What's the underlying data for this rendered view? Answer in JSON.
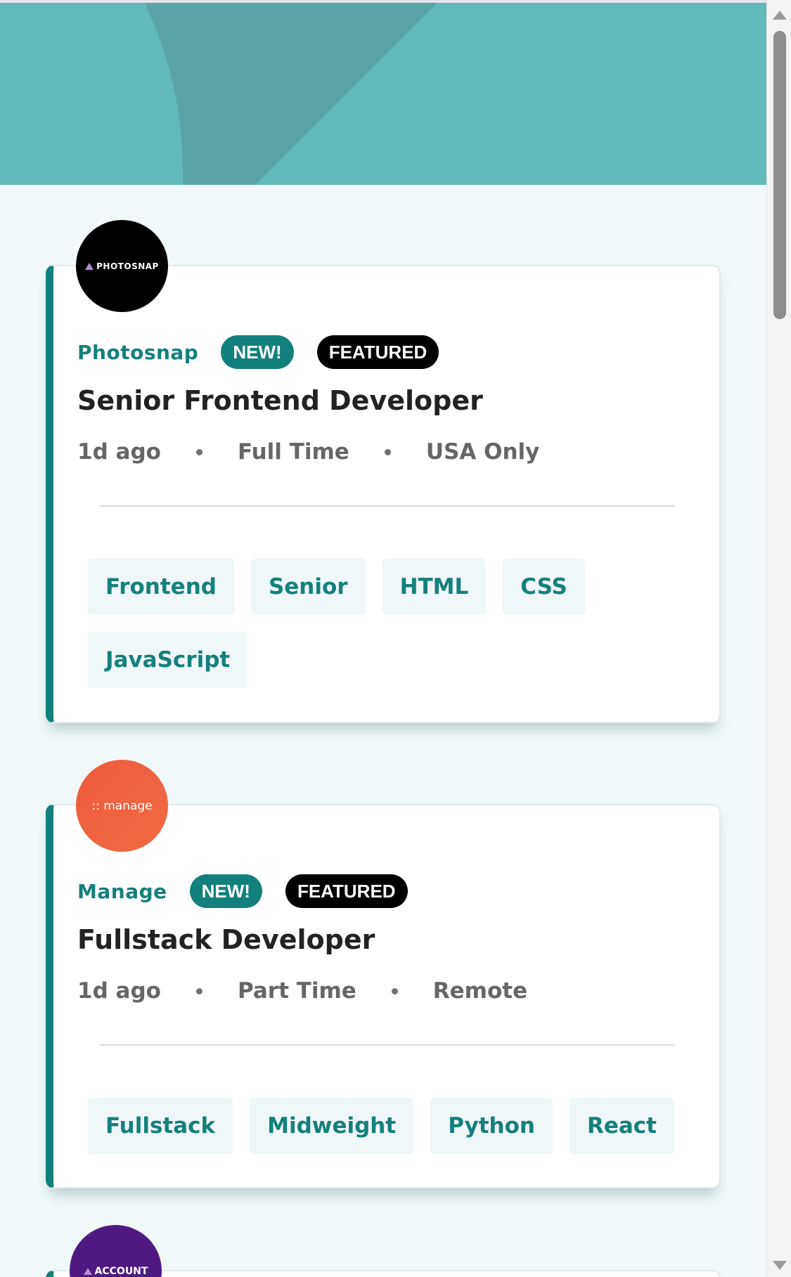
{
  "colors": {
    "primary": "#14807c",
    "header_bg": "#63baba",
    "page_bg": "#f0f8f9",
    "tag_bg": "#eff7f8",
    "featured_bg": "#000000",
    "text_dark": "#222222",
    "text_muted": "#666666"
  },
  "jobs": [
    {
      "logo_text": "PHOTOSNAP",
      "logo_icon": "triangle-logo-icon",
      "company": "Photosnap",
      "new_label": "NEW!",
      "featured_label": "FEATURED",
      "title": "Senior Frontend Developer",
      "posted": "1d ago",
      "contract": "Full Time",
      "location": "USA Only",
      "tags": [
        "Frontend",
        "Senior",
        "HTML",
        "CSS",
        "JavaScript"
      ]
    },
    {
      "logo_text": ":: manage",
      "company": "Manage",
      "new_label": "NEW!",
      "featured_label": "FEATURED",
      "title": "Fullstack Developer",
      "posted": "1d ago",
      "contract": "Part Time",
      "location": "Remote",
      "tags": [
        "Fullstack",
        "Midweight",
        "Python",
        "React"
      ]
    },
    {
      "logo_text": "ACCOUNT",
      "logo_icon": "triangle-logo-icon"
    }
  ]
}
